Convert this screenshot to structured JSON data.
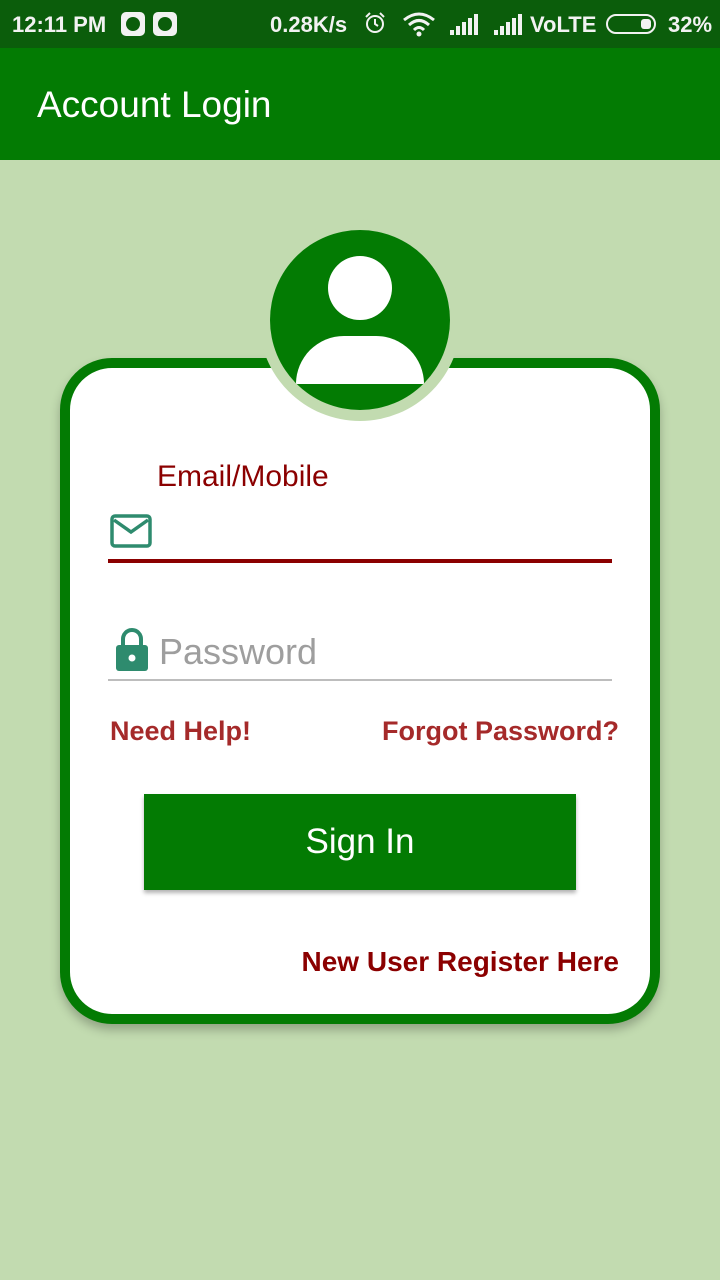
{
  "status_bar": {
    "time": "12:11 PM",
    "speed": "0.28K/s",
    "network": "VoLTE",
    "battery": "32%",
    "icons": [
      "whatsapp-icon",
      "whatsapp-icon",
      "alarm-icon",
      "wifi-icon",
      "signal-icon",
      "signal-icon",
      "battery-icon"
    ]
  },
  "app_bar": {
    "title": "Account Login"
  },
  "login": {
    "email_label": "Email/Mobile",
    "email_value": "",
    "password_placeholder": "Password",
    "need_help": "Need Help!",
    "forgot_password": "Forgot Password?",
    "sign_in": "Sign In",
    "register": "New User Register Here"
  },
  "colors": {
    "primary": "#037b03",
    "status_bar": "#0b5d0b",
    "background": "#c2dbb0",
    "label": "#8b0000",
    "link": "#a52a2a"
  }
}
